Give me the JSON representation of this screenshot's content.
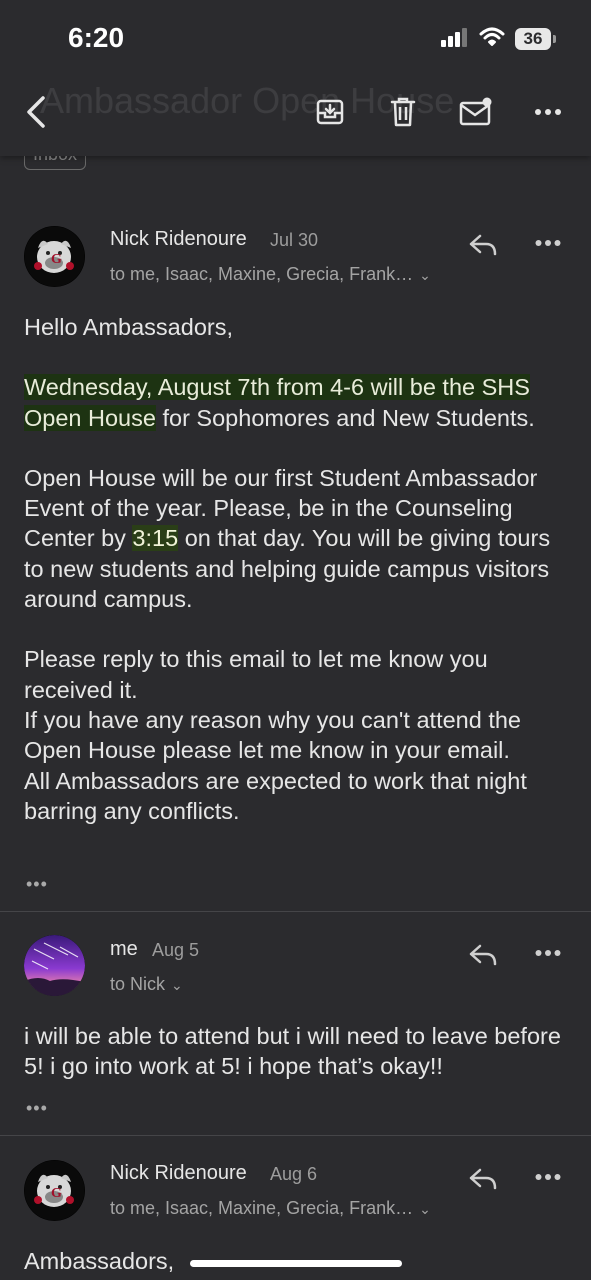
{
  "status_bar": {
    "time": "6:20",
    "battery": "36"
  },
  "toolbar": {
    "subject_ghost": "Ambassador Open House",
    "label_chip": "Inbox",
    "icons": [
      "back-icon",
      "archive-icon",
      "trash-icon",
      "mark-unread-icon",
      "more-icon"
    ]
  },
  "messages": [
    {
      "sender": "Nick Ridenoure",
      "date": "Jul 30",
      "recipients": "to me, Isaac, Maxine, Grecia, Frank…",
      "greeting": "Hello Ambassadors,",
      "p1_highlight": "Wednesday, August 7th from 4-6 will be the SHS Open House",
      "p1_rest": " for Sophomores and New Students.",
      "p2_before": "Open House will be our first Student Ambassador Event of the year. Please, be in the Counseling Center by ",
      "p2_time": "3:15",
      "p2_after": " on that day. You will be giving tours to new students and helping guide campus visitors around campus.",
      "p3_line1": "Please reply to this email to let me know you received it.",
      "p3_line2": "If you have any reason why you can't attend the Open House please let me know in your email.",
      "p3_line3": "All Ambassadors are expected to work that night barring any conflicts.",
      "dots": "•••"
    },
    {
      "sender": "me",
      "date": "Aug 5",
      "recipients": "to Nick",
      "body": "i will be able to attend but i will need to leave before 5! i go into work at 5! i hope that’s okay!!",
      "dots": "•••"
    },
    {
      "sender": "Nick Ridenoure",
      "date": "Aug 6",
      "recipients": "to me, Isaac, Maxine, Grecia, Frank…",
      "greeting": "Ambassadors,"
    }
  ]
}
